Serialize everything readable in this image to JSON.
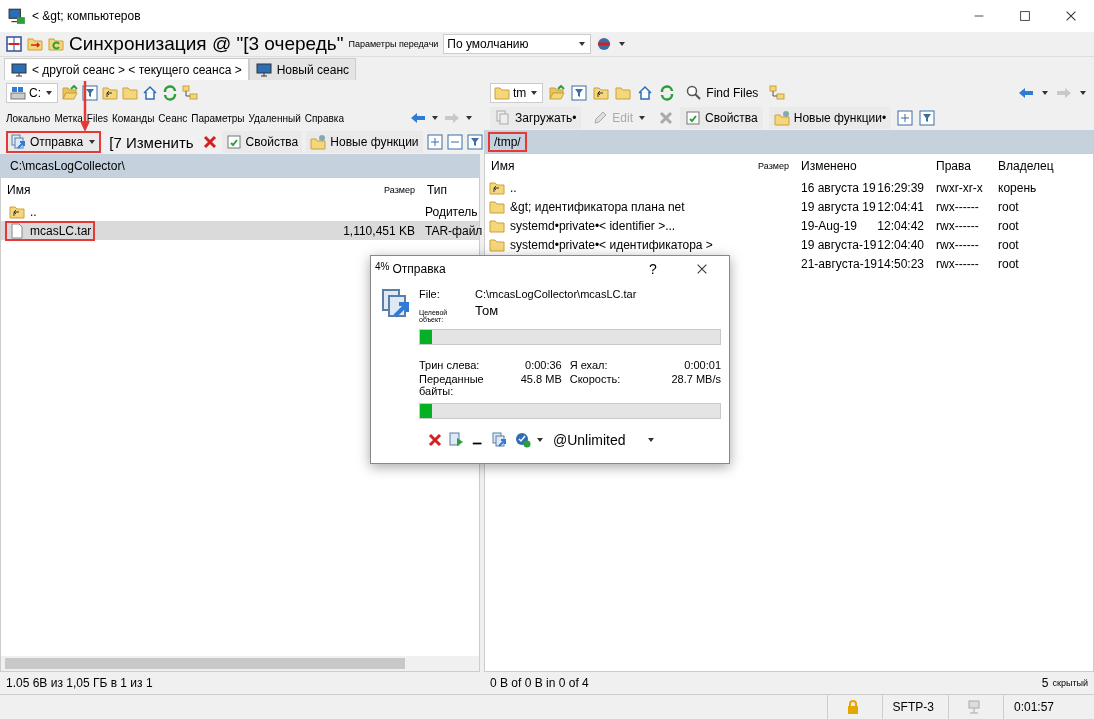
{
  "window": {
    "title": "< &gt; компьютеров"
  },
  "toolbar": {
    "sync_label": "Синхронизация @ \"[3 очередь\"",
    "transfer_settings_label": "Параметры передачи",
    "transfer_preset": "По умолчанию"
  },
  "session_tabs": [
    {
      "label": "< другой сеанс > < текущего сеанса >",
      "selected": true
    },
    {
      "label": "Новый сеанс",
      "selected": false
    }
  ],
  "local_panel": {
    "drive": "C:",
    "menu": [
      "Локально",
      "Метка",
      "Files",
      "Команды",
      "Сеанс",
      "Параметры",
      "Удаленный",
      "Справка"
    ],
    "actions": [
      {
        "label": "Отправка",
        "kind": "upload",
        "highlighted": true
      },
      {
        "label": "[7 Изменить",
        "kind": "edit",
        "highlighted": false
      },
      {
        "label": "Свойства",
        "kind": "properties",
        "highlighted": false
      },
      {
        "label": "Новые функции",
        "kind": "new",
        "highlighted": false
      }
    ],
    "path": "C:\\mcasLogCollector\\",
    "path_highlighted": false,
    "columns": [
      "Имя",
      "Размер",
      "Тип"
    ],
    "rows": [
      {
        "name": "..",
        "type": "Родитель",
        "kind": "parent",
        "selected": false,
        "highlighted": false
      },
      {
        "name": "mcasLC.tar",
        "size": "1,110,451 KB",
        "type": "TAR-файл",
        "kind": "file",
        "selected": true,
        "highlighted": true
      }
    ],
    "status": "1.05 6В из 1,05 ГБ в 1 из 1"
  },
  "remote_panel": {
    "drive": "tm",
    "find": "Find Files",
    "actions": [
      {
        "label": "Загружать•",
        "kind": "download",
        "disabled": false
      },
      {
        "label": "Edit",
        "kind": "edit",
        "disabled": true
      },
      {
        "label": "Свойства",
        "kind": "properties",
        "disabled": false
      },
      {
        "label": "Новые функции•",
        "kind": "new",
        "disabled": false
      }
    ],
    "path": "/tmp/",
    "path_highlighted": true,
    "columns": [
      "Имя",
      "Размер",
      "Изменено",
      "Права",
      "Владелец"
    ],
    "rows": [
      {
        "name": "..",
        "kind": "parent",
        "date": "16 августа 19",
        "time": "16:29:39",
        "rights": "rwxr-xr-x",
        "owner": "корень"
      },
      {
        "name": "&gt; идентификатора плана net",
        "kind": "folder",
        "date": "19 августа 19",
        "time": "12:04:41",
        "rights": "rwx------",
        "owner": "root"
      },
      {
        "name": "systemd•private•< identifier >...",
        "kind": "folder",
        "date": "19-Aug-19",
        "time": "12:04:42",
        "rights": "rwx------",
        "owner": "root"
      },
      {
        "name": "systemd•private•< идентификатора >",
        "kind": "folder",
        "date": "19 августа-19",
        "time": "12:04:40",
        "rights": "rwx------",
        "owner": "root"
      },
      {
        "date": "21-августа-19",
        "time": "14:50:23",
        "rights": "rwx------",
        "owner": "root"
      }
    ],
    "status": "0 B of 0 B in 0 of 4",
    "hidden_count": "5",
    "hidden_label": "скрытый"
  },
  "dialog": {
    "percent": "4%",
    "title": "Отправка",
    "help": "?",
    "file_label": "File:",
    "file": "C:\\mcasLogCollector\\mcasLC.tar",
    "target_label": "Целевой объект:",
    "target": "Том",
    "file_progress": {
      "level": 0.04
    },
    "stats": [
      {
        "label": "Трин слева:",
        "value": "0:00:36"
      },
      {
        "label": "Я ехал:",
        "value": "0:00:01"
      },
      {
        "label": "Переданные байты:",
        "value": "45.8 MB"
      },
      {
        "label": "Скорость:",
        "value": "28.7 MB/s"
      }
    ],
    "total_progress": {
      "level": 0.04
    },
    "speed_limit": "@Unlimited"
  },
  "status_bar": {
    "protocol": "SFTP-3",
    "elapsed": "0:01:57"
  }
}
